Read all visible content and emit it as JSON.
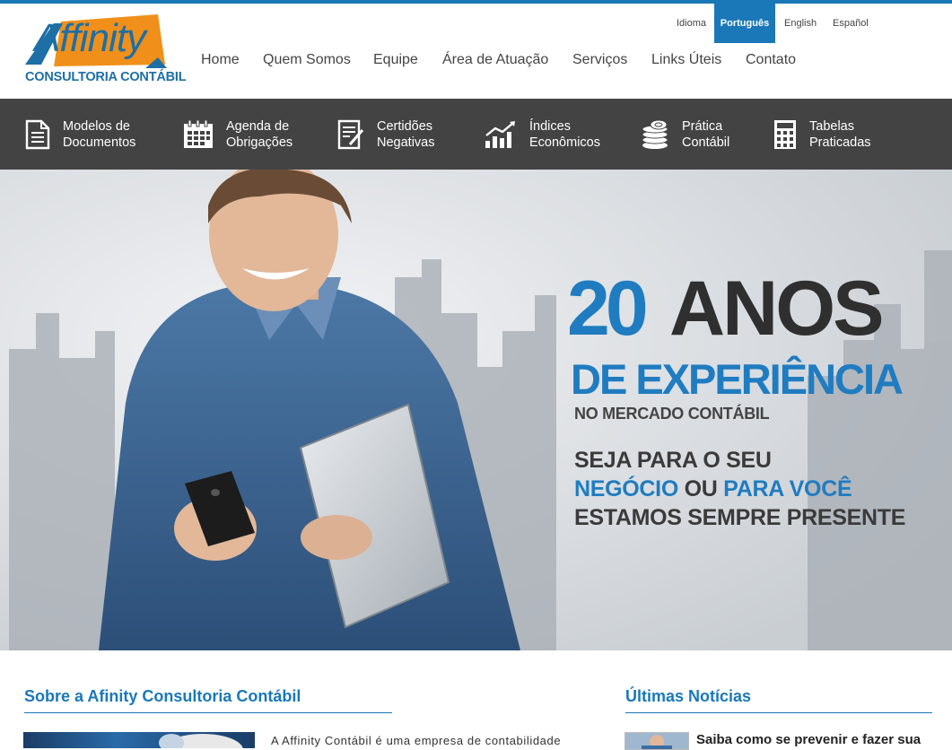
{
  "logo": {
    "name": "Affinity",
    "tagline": "CONSULTORIA CONTÁBIL"
  },
  "language": {
    "label": "Idioma",
    "options": [
      "Português",
      "English",
      "Español"
    ]
  },
  "nav": [
    "Home",
    "Quem Somos",
    "Equipe",
    "Área de Atuação",
    "Serviços",
    "Links Úteis",
    "Contato"
  ],
  "toolbar": [
    {
      "icon": "document-icon",
      "label": "Modelos de\nDocumentos"
    },
    {
      "icon": "calendar-icon",
      "label": "Agenda de\nObrigações"
    },
    {
      "icon": "certificate-icon",
      "label": "Certidões\nNegativas"
    },
    {
      "icon": "chart-icon",
      "label": "Índices\nEconômicos"
    },
    {
      "icon": "coins-icon",
      "label": "Prática\nContábil"
    },
    {
      "icon": "calculator-icon",
      "label": "Tabelas\nPraticadas"
    }
  ],
  "hero": {
    "number": "20",
    "anos": "ANOS",
    "experiencia": "DE EXPERIÊNCIA",
    "mercado": "NO MERCADO CONTÁBIL",
    "line1": "SEJA PARA O SEU",
    "line2a": "NEGÓCIO",
    "line2b": " OU ",
    "line2c": "PARA VOCÊ",
    "line3": "ESTAMOS SEMPRE PRESENTE"
  },
  "about": {
    "title": "Sobre a Afinity Consultoria Contábil",
    "text": "A Affinity Contábil é uma empresa de contabilidade"
  },
  "news": {
    "title": "Últimas Notícias",
    "item": "Saiba como se prevenir e fazer sua"
  },
  "colors": {
    "accent": "#1a78b8",
    "toolbar": "#434343",
    "logo_orange": "#f0901a"
  }
}
